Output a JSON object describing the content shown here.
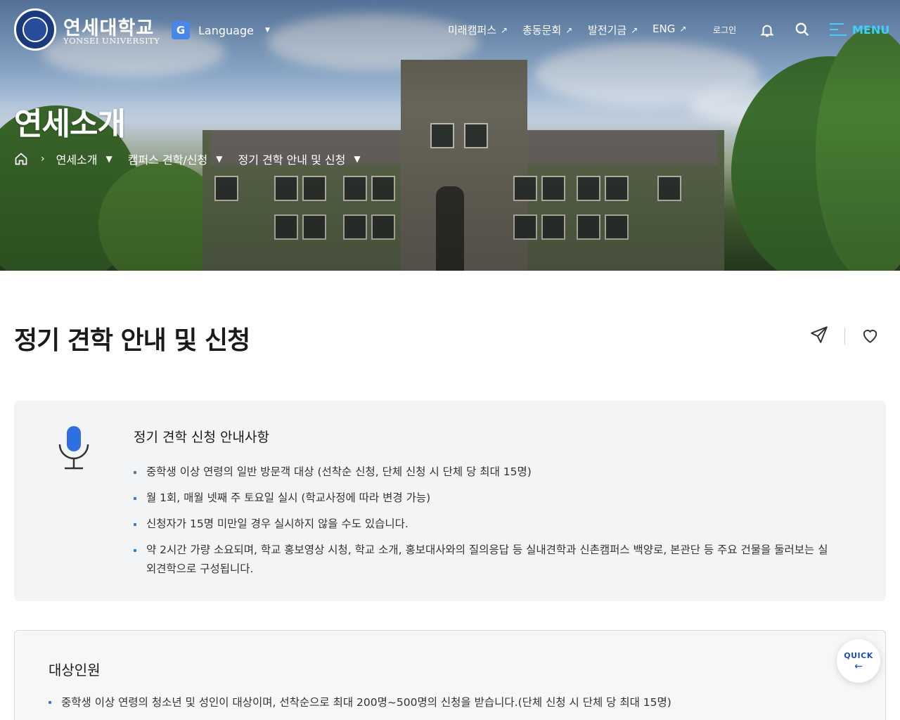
{
  "header": {
    "logo_kr": "연세대학교",
    "logo_en": "YONSEI UNIVERSITY",
    "language_label": "Language",
    "language_icon": "translate-icon",
    "nav": [
      {
        "label": "미래캠퍼스",
        "icon": "external-arrow-icon"
      },
      {
        "label": "총동문회",
        "icon": "external-arrow-icon"
      },
      {
        "label": "발전기금",
        "icon": "external-arrow-icon"
      },
      {
        "label": "ENG",
        "icon": "external-arrow-icon"
      }
    ],
    "login_label": "로그인",
    "menu_label": "MENU",
    "menu_color": "#3fd0f5"
  },
  "hero": {
    "title": "연세소개",
    "breadcrumbs": [
      {
        "label": "연세소개"
      },
      {
        "label": "캠퍼스 견학/신청"
      },
      {
        "label": "정기 견학 안내 및 신청"
      }
    ]
  },
  "main": {
    "page_title": "정기 견학 안내 및 신청",
    "notice": {
      "title": "정기 견학 신청 안내사항",
      "items": [
        "중학생 이상 연령의 일반 방문객 대상 (선착순 신청, 단체 신청 시 단체 당 최대 15명)",
        "월 1회, 매월 넷째 주 토요일 실시 (학교사정에 따라 변경 가능)",
        "신청자가 15명 미만일 경우 실시하지 않을 수도 있습니다.",
        "약 2시간 가량 소요되며, 학교 홍보영상 시청, 학교 소개, 홍보대사와의 질의응답 등 실내견학과 신촌캠퍼스 백양로, 본관단 등 주요 건물을 둘러보는 실외견학으로 구성됩니다."
      ]
    },
    "target": {
      "title": "대상인원",
      "text": "중학생 이상 연령의 청소년 및 성인이 대상이며, 선착순으로 최대 200명~500명의 신청을 받습니다.(단체 신청 시 단체 당 최대 15명)"
    },
    "quick": {
      "label": "QUICK",
      "arrow": "←"
    }
  },
  "colors": {
    "accent_blue": "#2f7bd8",
    "brand_navy": "#1a3a7e",
    "quick_blue": "#1d4fb8"
  }
}
